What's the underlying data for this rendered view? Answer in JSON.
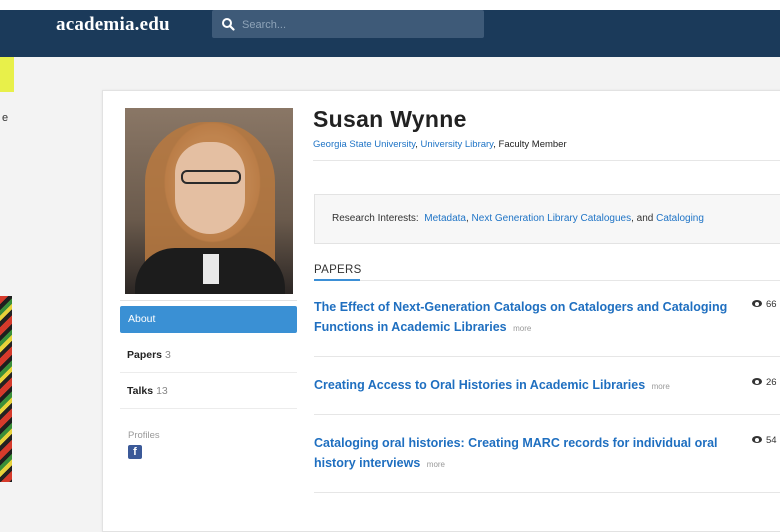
{
  "header": {
    "logo": "academia.edu",
    "search": {
      "placeholder": "Search..."
    }
  },
  "background": {
    "partial_text": "e"
  },
  "profile": {
    "name": "Susan Wynne",
    "university": "Georgia State University",
    "department": "University Library",
    "role": "Faculty Member",
    "comma": ", "
  },
  "interests": {
    "label": "Research Interests:",
    "items": [
      "Metadata",
      "Next Generation Library Catalogues",
      "Cataloging"
    ],
    "joiner": ", ",
    "and": ", and "
  },
  "papers": {
    "heading": "PAPERS",
    "more_label": "more",
    "items": [
      {
        "title": "The Effect of Next-Generation Catalogs on Catalogers and Cataloging Functions in Academic Libraries",
        "views": "66"
      },
      {
        "title": "Creating Access to Oral Histories in Academic Libraries",
        "views": "26"
      },
      {
        "title": "Cataloging oral histories: Creating MARC records for individual oral history interviews",
        "views": "54"
      }
    ]
  },
  "nav": {
    "about": "About",
    "papers_label": "Papers",
    "papers_count": "3",
    "talks_label": "Talks",
    "talks_count": "13",
    "profiles_label": "Profiles",
    "facebook_glyph": "f"
  },
  "colors": {
    "header_bg": "#1b3a5a",
    "link": "#1f74c6",
    "nav_active": "#3a90d4",
    "facebook": "#3b5998"
  }
}
